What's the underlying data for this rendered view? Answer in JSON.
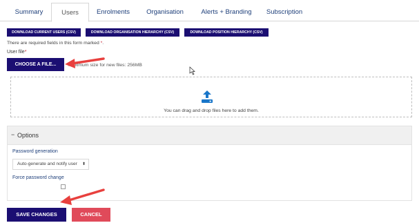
{
  "tabs": [
    {
      "label": "Summary"
    },
    {
      "label": "Users"
    },
    {
      "label": "Enrolments"
    },
    {
      "label": "Organisation"
    },
    {
      "label": "Alerts + Branding"
    },
    {
      "label": "Subscription"
    }
  ],
  "downloads": [
    {
      "label": "DOWNLOAD CURRENT USERS (CSV)"
    },
    {
      "label": "DOWNLOAD ORGANISATION HIERARCHY (CSV)"
    },
    {
      "label": "DOWNLOAD POSITION HIERARCHY (CSV)"
    }
  ],
  "form": {
    "required_note": "There are required fields in this form marked",
    "required_star": "*",
    "user_file_label": "User file",
    "choose_button": "CHOOSE A FILE...",
    "max_size": "Maximum size for new files: 256MB",
    "drop_text": "You can drag and drop files here to add them."
  },
  "options": {
    "toggle": "−",
    "title": "Options",
    "password_label": "Password generation",
    "password_value": "Auto-generate and notify user",
    "password_caret": "⬍",
    "force_label": "Force password change"
  },
  "actions": {
    "save": "SAVE CHANGES",
    "cancel": "CANCEL"
  },
  "colors": {
    "primary": "#1b0e72",
    "cancel": "#e04a5a",
    "arrow": "#e8403e",
    "upload_icon": "#1976c9"
  }
}
